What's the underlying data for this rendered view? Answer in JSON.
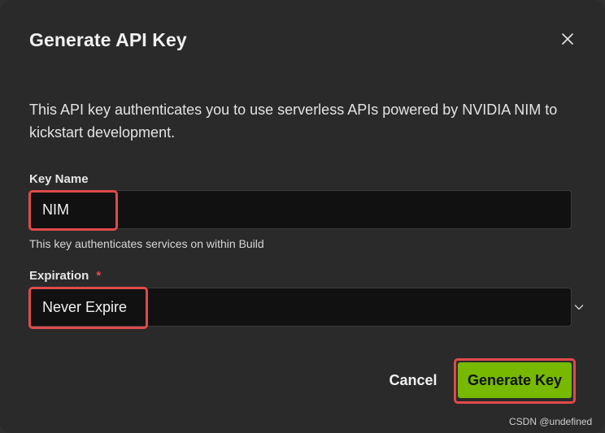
{
  "dialog": {
    "title": "Generate API Key",
    "close_icon": "close-icon",
    "description": "This API key authenticates you to use serverless APIs powered by NVIDIA NIM to kickstart development."
  },
  "key_name": {
    "label": "Key Name",
    "value": "NIM",
    "hint": "This key authenticates services on within Build"
  },
  "expiration": {
    "label": "Expiration",
    "required_marker": "*",
    "selected": "Never Expire",
    "icon": "chevron-down-icon"
  },
  "actions": {
    "cancel_label": "Cancel",
    "generate_label": "Generate Key"
  },
  "watermark": "CSDN @undefined",
  "colors": {
    "dialog_bg": "#2a2a2a",
    "input_bg": "#111111",
    "accent_green": "#76b900",
    "highlight_red": "#e04a4a",
    "required_red": "#e34a4a"
  }
}
